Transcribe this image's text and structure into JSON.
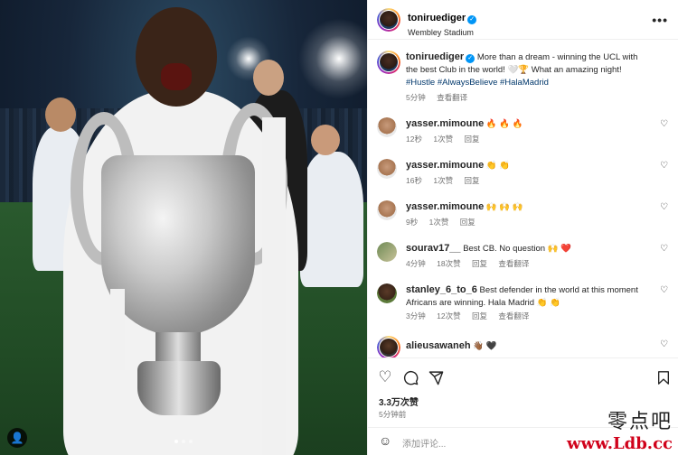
{
  "post": {
    "username": "toniruediger",
    "location": "Wembley Stadium",
    "caption_username": "toniruediger",
    "caption_text": "More than a dream - winning the UCL with the best Club in the world! 🤍🏆 What an amazing night!",
    "caption_tags": "#Hustle #AlwaysBelieve #HalaMadrid",
    "caption_time": "5分钟",
    "caption_translate": "查看翻译",
    "likes": "3.3万次赞",
    "time_ago": "5分钟前",
    "comment_placeholder": "添加评论...",
    "more_label": "•••"
  },
  "comments": [
    {
      "username": "yasser.mimoune",
      "text": "🔥 🔥 🔥",
      "time": "12秒",
      "likes": "1次赞",
      "reply": "回复"
    },
    {
      "username": "yasser.mimoune",
      "text": "👏 👏",
      "time": "16秒",
      "likes": "1次赞",
      "reply": "回复"
    },
    {
      "username": "yasser.mimoune",
      "text": "🙌 🙌 🙌",
      "time": "9秒",
      "likes": "1次赞",
      "reply": "回复"
    },
    {
      "username": "sourav17__",
      "text": "Best CB. No question 🙌 ❤️",
      "time": "4分钟",
      "likes": "18次赞",
      "reply": "回复",
      "translate": "查看翻译"
    },
    {
      "username": "stanley_6_to_6",
      "text": "Best defender in the world at this moment Africans are winning. Hala Madrid 👏 👏",
      "time": "3分钟",
      "likes": "12次赞",
      "reply": "回复",
      "translate": "查看翻译"
    },
    {
      "username": "alieusawaneh",
      "text": "👋🏾 🖤",
      "time": "",
      "likes": "",
      "reply": ""
    }
  ],
  "icons": {
    "heart": "heart-icon",
    "comment": "comment-icon",
    "share": "share-icon",
    "bookmark": "bookmark-icon",
    "emoji": "emoji-icon",
    "more": "more-icon",
    "verified": "verified-icon"
  },
  "watermark": {
    "cn": "零点吧",
    "url": "www.Ldb.cc"
  },
  "colors": {
    "accent_blue": "#0095f6",
    "link": "#00376b",
    "muted": "#737373",
    "watermark_red": "#d0021b"
  }
}
